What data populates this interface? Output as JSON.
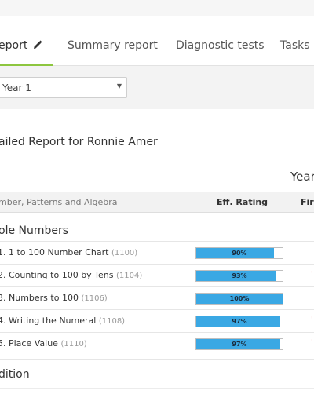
{
  "tabs": [
    {
      "label": "eport",
      "active": true
    },
    {
      "label": "Summary report",
      "active": false
    },
    {
      "label": "Diagnostic tests",
      "active": false
    },
    {
      "label": "Tasks",
      "active": false
    }
  ],
  "year_select": {
    "value": "Year 1"
  },
  "report_title": "ailed Report for Ronnie Amer",
  "year_heading": "Year",
  "table": {
    "category_header": "mber, Patterns and Algebra",
    "eff_rating_header": "Eff. Rating",
    "first_header": "Firs"
  },
  "sections": [
    {
      "title": "ole Numbers"
    },
    {
      "title": "dition"
    }
  ],
  "rows": [
    {
      "label": "1. 1 to 100 Number Chart",
      "code": "(1100)",
      "rating": "90%",
      "rating_value": 90
    },
    {
      "label": "2. Counting to 100 by Tens",
      "code": "(1104)",
      "rating": "93%",
      "rating_value": 93
    },
    {
      "label": "3. Numbers to 100",
      "code": "(1106)",
      "rating": "100%",
      "rating_value": 100
    },
    {
      "label": "4. Writing the Numeral",
      "code": "(1108)",
      "rating": "97%",
      "rating_value": 97
    },
    {
      "label": "5. Place Value",
      "code": "(1110)",
      "rating": "97%",
      "rating_value": 97
    }
  ],
  "colors": {
    "accent_green": "#8dc63f",
    "bar_blue": "#3aa8e4"
  },
  "icons": {
    "edit": "pencil-icon",
    "dropdown": "caret-down-icon"
  }
}
